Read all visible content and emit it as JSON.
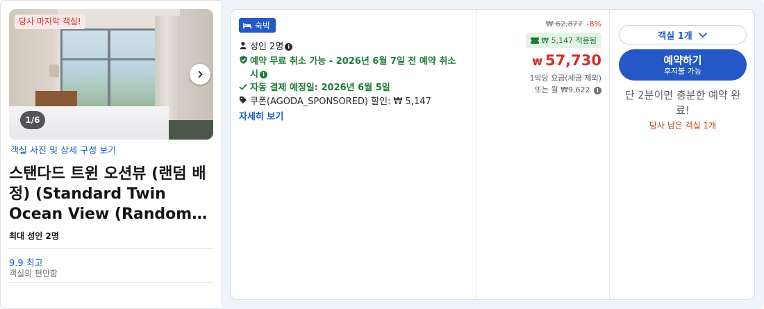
{
  "photo": {
    "badge": "당사 마지막 객실!",
    "counter": "1/6",
    "link": "객실 사진 및 상세 구성 보기"
  },
  "room": {
    "title": "스탠다드 트윈 오션뷰 (랜덤 배정) (Standard Twin Ocean View (Random…",
    "max_occupancy": "최대 성인 2명",
    "score": "9.9 최고",
    "score_label": "객실의 편안함"
  },
  "offer": {
    "tag": "숙박",
    "guests": "성인 2명",
    "free_cancel": "예약 무료 취소 가능 - 2026년 6월 7일 전 예약 취소 시",
    "auto_pay": "자동 결제 예정일: 2026년 6월 5일",
    "coupon": "쿠폰(AGODA_SPONSORED) 할인: ₩ 5,147",
    "details_link": "자세히 보기"
  },
  "pricing": {
    "original": "₩ 62,877",
    "discount_pct": "-8%",
    "applied": "₩ 5,147 적용됨",
    "currency": "₩",
    "price": "57,730",
    "per_night": "1박당 요금(세금 제외)",
    "monthly": "또는 월 ₩9,622"
  },
  "booking": {
    "room_select": "객실 1개",
    "book_label": "예약하기",
    "book_sub": "후지불 가능",
    "urgency": "단 2분이면 충분한 예약 완료!",
    "rooms_left": "당사 남은 객실 1개"
  },
  "colors": {
    "brand_blue": "#2458c6",
    "price_red": "#d4302b",
    "green": "#1f7a3a"
  }
}
